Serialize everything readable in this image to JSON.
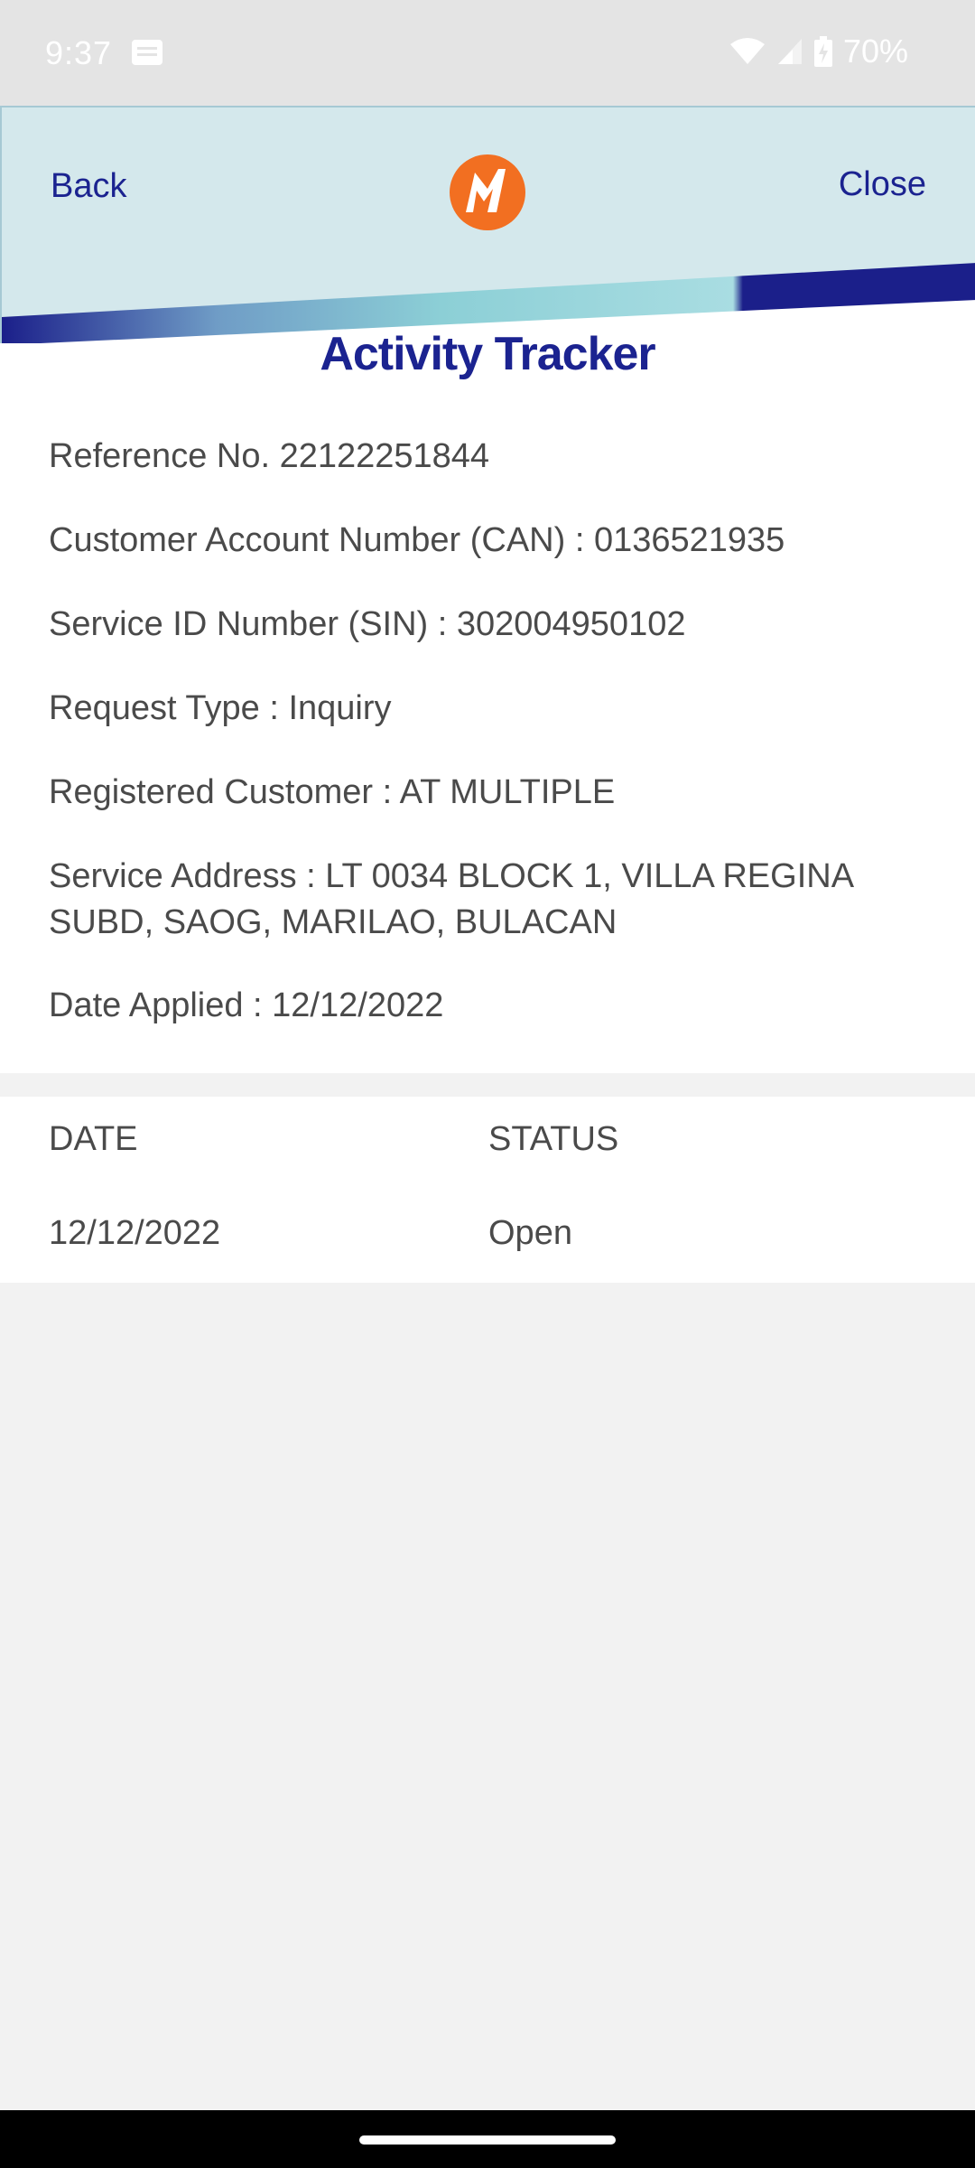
{
  "status_bar": {
    "time": "9:37",
    "battery": "70%",
    "icons": [
      "g-icon",
      "wifi-icon",
      "signal-icon",
      "battery-charging-icon"
    ]
  },
  "header": {
    "back_label": "Back",
    "close_label": "Close",
    "logo_icon": "meralco-logo",
    "colors": {
      "background": "#d4e8ec",
      "navy": "#1b2390",
      "teal": "#8ccfd6",
      "logo": "#f26f21"
    }
  },
  "page": {
    "title": "Activity Tracker"
  },
  "details": {
    "reference": "Reference No. 22122251844",
    "can": "Customer Account Number (CAN) : 0136521935",
    "sin": "Service ID Number (SIN) : 302004950102",
    "request_type": "Request Type : Inquiry",
    "registered_customer": "Registered Customer : AT MULTIPLE",
    "service_address": "Service Address : LT 0034 BLOCK 1, VILLA REGINA SUBD, SAOG, MARILAO, BULACAN",
    "date_applied": "Date Applied : 12/12/2022"
  },
  "status_table": {
    "headers": [
      "DATE",
      "STATUS"
    ],
    "rows": [
      [
        "12/12/2022",
        "Open"
      ]
    ]
  }
}
